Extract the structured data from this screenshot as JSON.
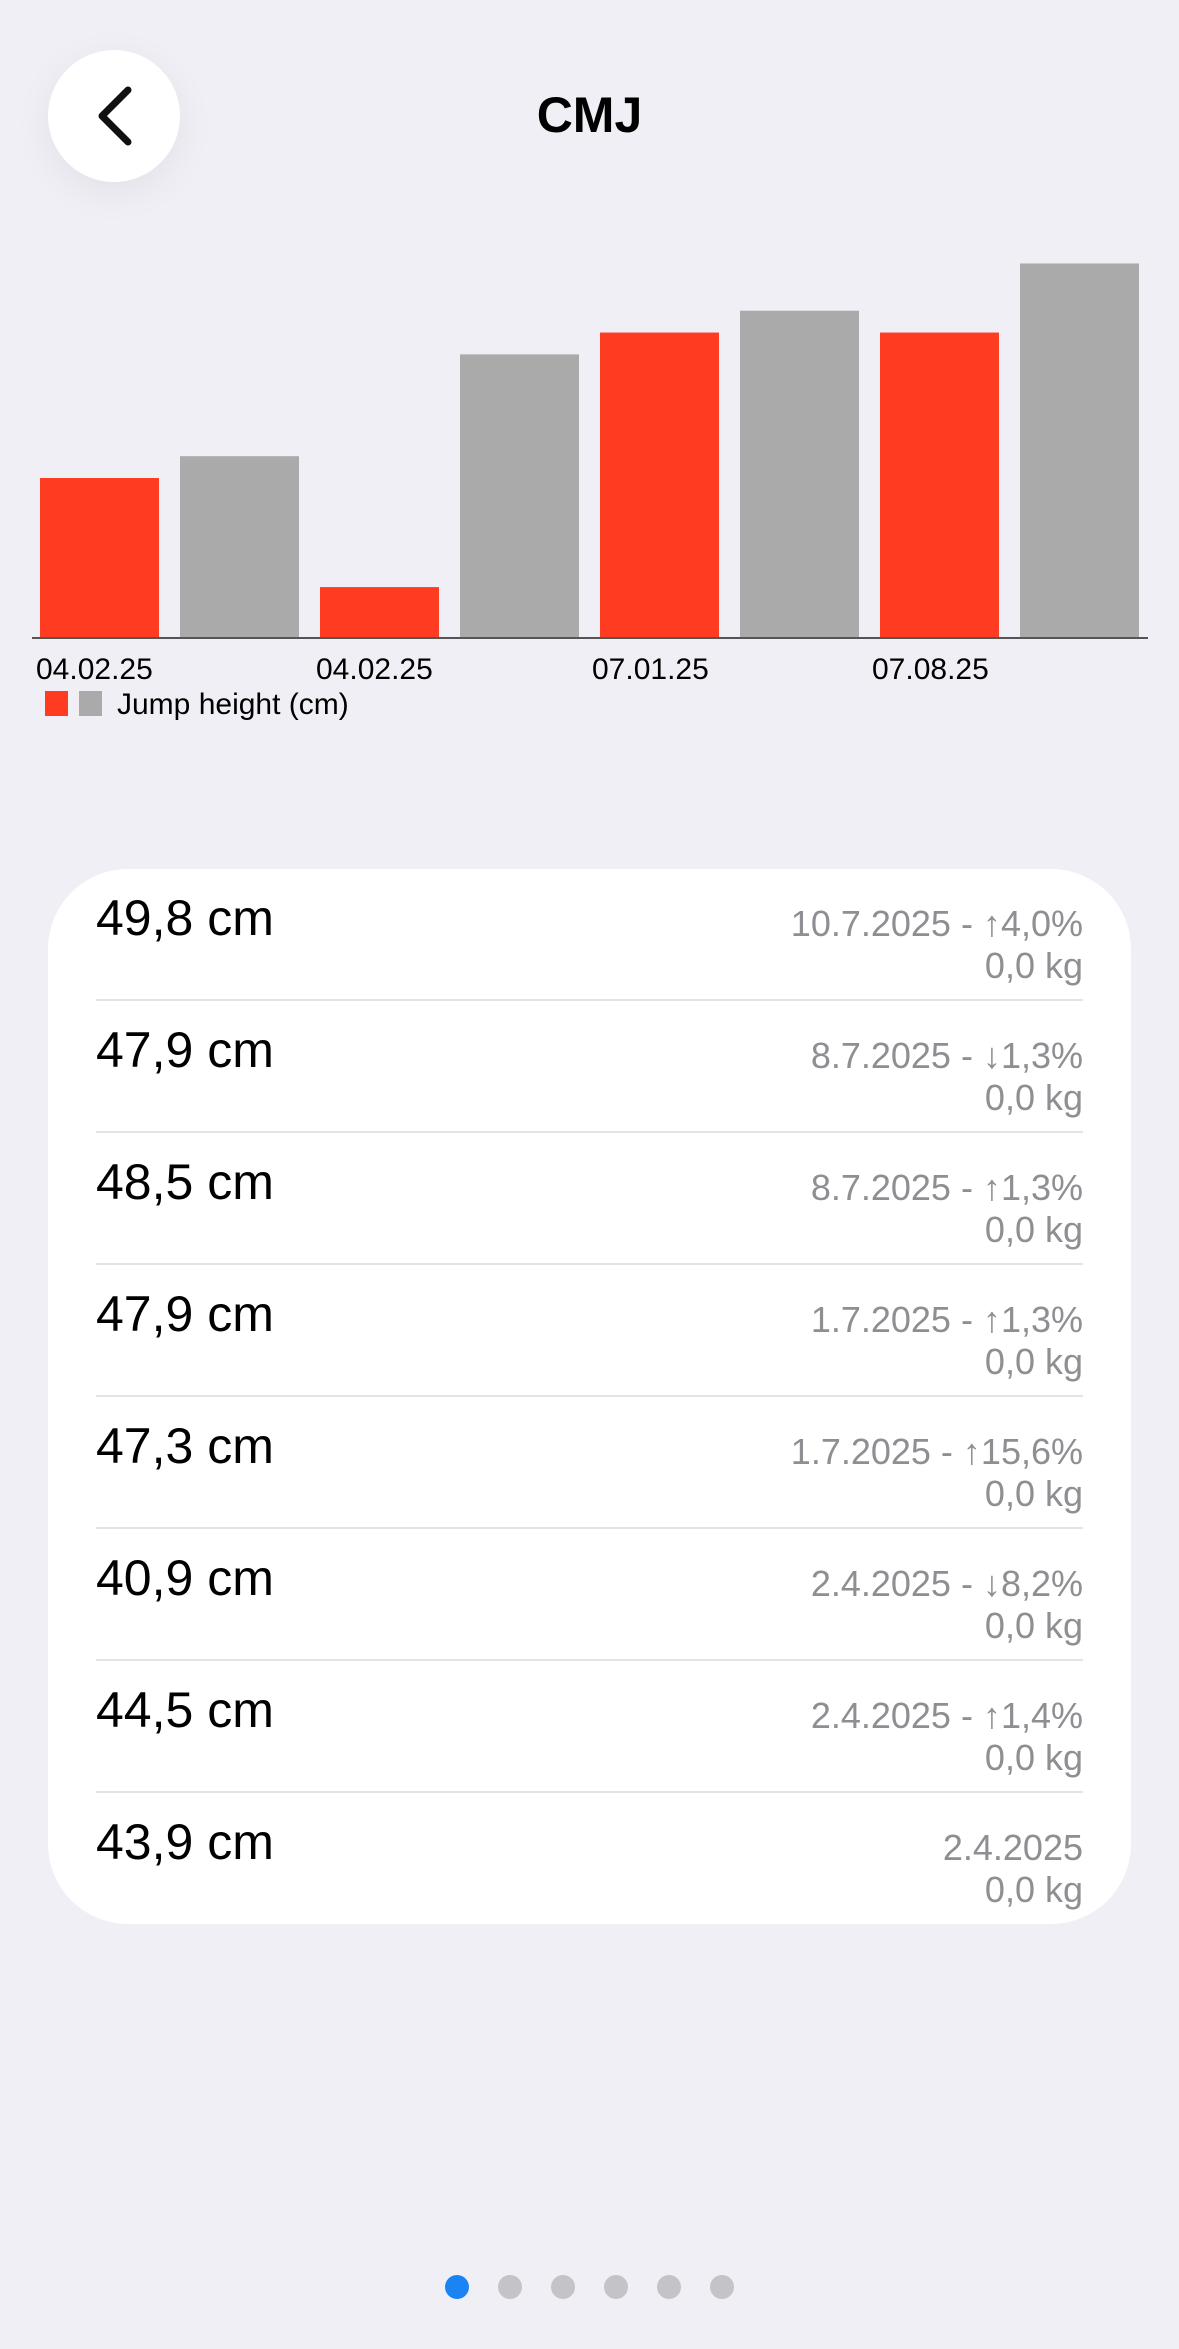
{
  "header": {
    "title": "CMJ",
    "back_icon": "chevron-left-icon"
  },
  "chart_data": {
    "type": "bar",
    "title": "",
    "xlabel": "",
    "ylabel": "",
    "grid": false,
    "legend_label": "Jump height (cm)",
    "legend_placement": "bottom-left",
    "colors": {
      "highlight": "#ff3b22",
      "normal": "#aaaaaa"
    },
    "x_tick_labels": [
      "04.02.25",
      "04.02.25",
      "07.01.25",
      "07.08.25"
    ],
    "bars": [
      {
        "value": 43.9,
        "color": "highlight"
      },
      {
        "value": 44.5,
        "color": "normal"
      },
      {
        "value": 40.9,
        "color": "highlight"
      },
      {
        "value": 47.3,
        "color": "normal"
      },
      {
        "value": 47.9,
        "color": "highlight"
      },
      {
        "value": 48.5,
        "color": "normal"
      },
      {
        "value": 47.9,
        "color": "highlight"
      },
      {
        "value": 49.8,
        "color": "normal"
      }
    ],
    "ylim": [
      39.5,
      50.5
    ]
  },
  "list": {
    "items": [
      {
        "value": "49,8 cm",
        "line1": "10.7.2025 - ↑4,0%",
        "line2": "0,0 kg"
      },
      {
        "value": "47,9 cm",
        "line1": "8.7.2025 - ↓1,3%",
        "line2": "0,0 kg"
      },
      {
        "value": "48,5 cm",
        "line1": "8.7.2025 - ↑1,3%",
        "line2": "0,0 kg"
      },
      {
        "value": "47,9 cm",
        "line1": "1.7.2025 - ↑1,3%",
        "line2": "0,0 kg"
      },
      {
        "value": "47,3 cm",
        "line1": "1.7.2025 - ↑15,6%",
        "line2": "0,0 kg"
      },
      {
        "value": "40,9 cm",
        "line1": "2.4.2025 - ↓8,2%",
        "line2": "0,0 kg"
      },
      {
        "value": "44,5 cm",
        "line1": "2.4.2025 - ↑1,4%",
        "line2": "0,0 kg"
      },
      {
        "value": "43,9 cm",
        "line1": "2.4.2025",
        "line2": "0,0 kg"
      }
    ]
  },
  "pager": {
    "count": 6,
    "active_index": 0,
    "active_color": "#1a84f5",
    "inactive_color": "#c4c4c8"
  }
}
